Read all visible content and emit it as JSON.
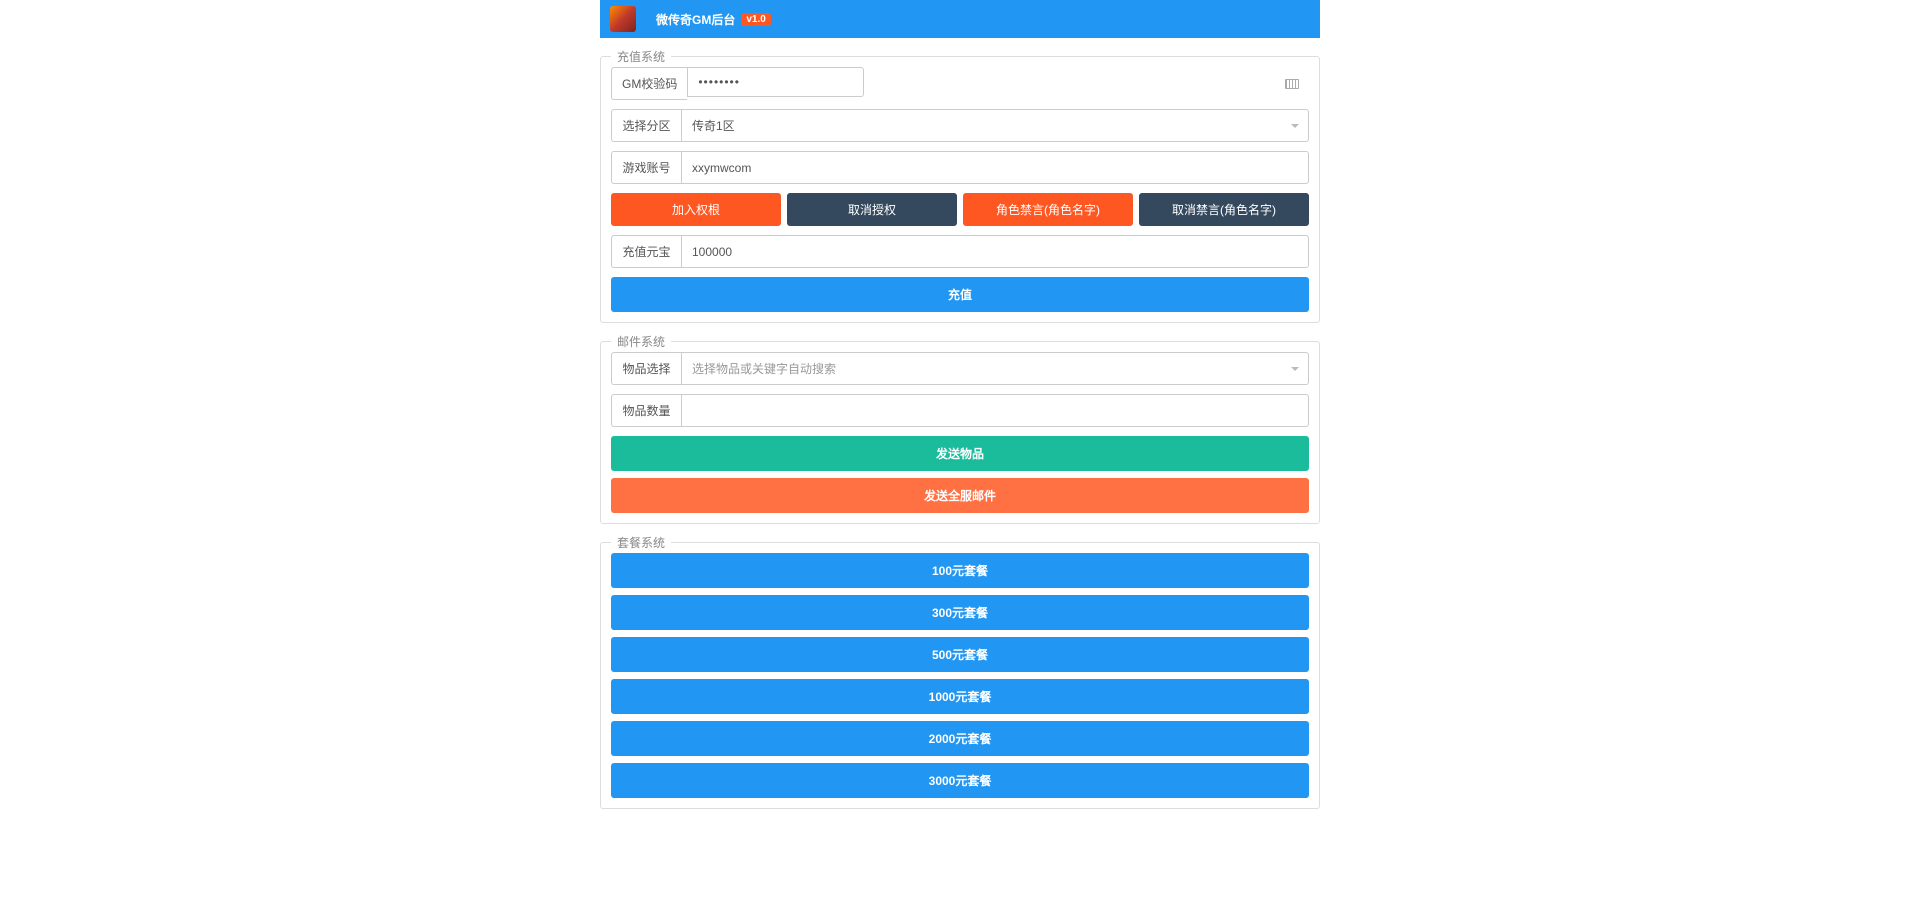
{
  "header": {
    "title": "微传奇GM后台",
    "version": "v1.0"
  },
  "recharge": {
    "legend": "充值系统",
    "gm_code_label": "GM校验码",
    "gm_code_value": "••••••••",
    "zone_label": "选择分区",
    "zone_value": "传奇1区",
    "account_label": "游戏账号",
    "account_value": "xxymwcom",
    "buttons": {
      "add_auth": "加入权根",
      "cancel_auth": "取消授权",
      "ban_role": "角色禁言(角色名字)",
      "unban_role": "取消禁言(角色名字)"
    },
    "amount_label": "充值元宝",
    "amount_value": "100000",
    "recharge_button": "充值"
  },
  "mail": {
    "legend": "邮件系统",
    "item_select_label": "物品选择",
    "item_select_placeholder": "选择物品或关键字自动搜索",
    "item_count_label": "物品数量",
    "item_count_value": "",
    "send_item_button": "发送物品",
    "send_all_mail_button": "发送全服邮件"
  },
  "packages": {
    "legend": "套餐系统",
    "items": [
      "100元套餐",
      "300元套餐",
      "500元套餐",
      "1000元套餐",
      "2000元套餐",
      "3000元套餐"
    ]
  }
}
